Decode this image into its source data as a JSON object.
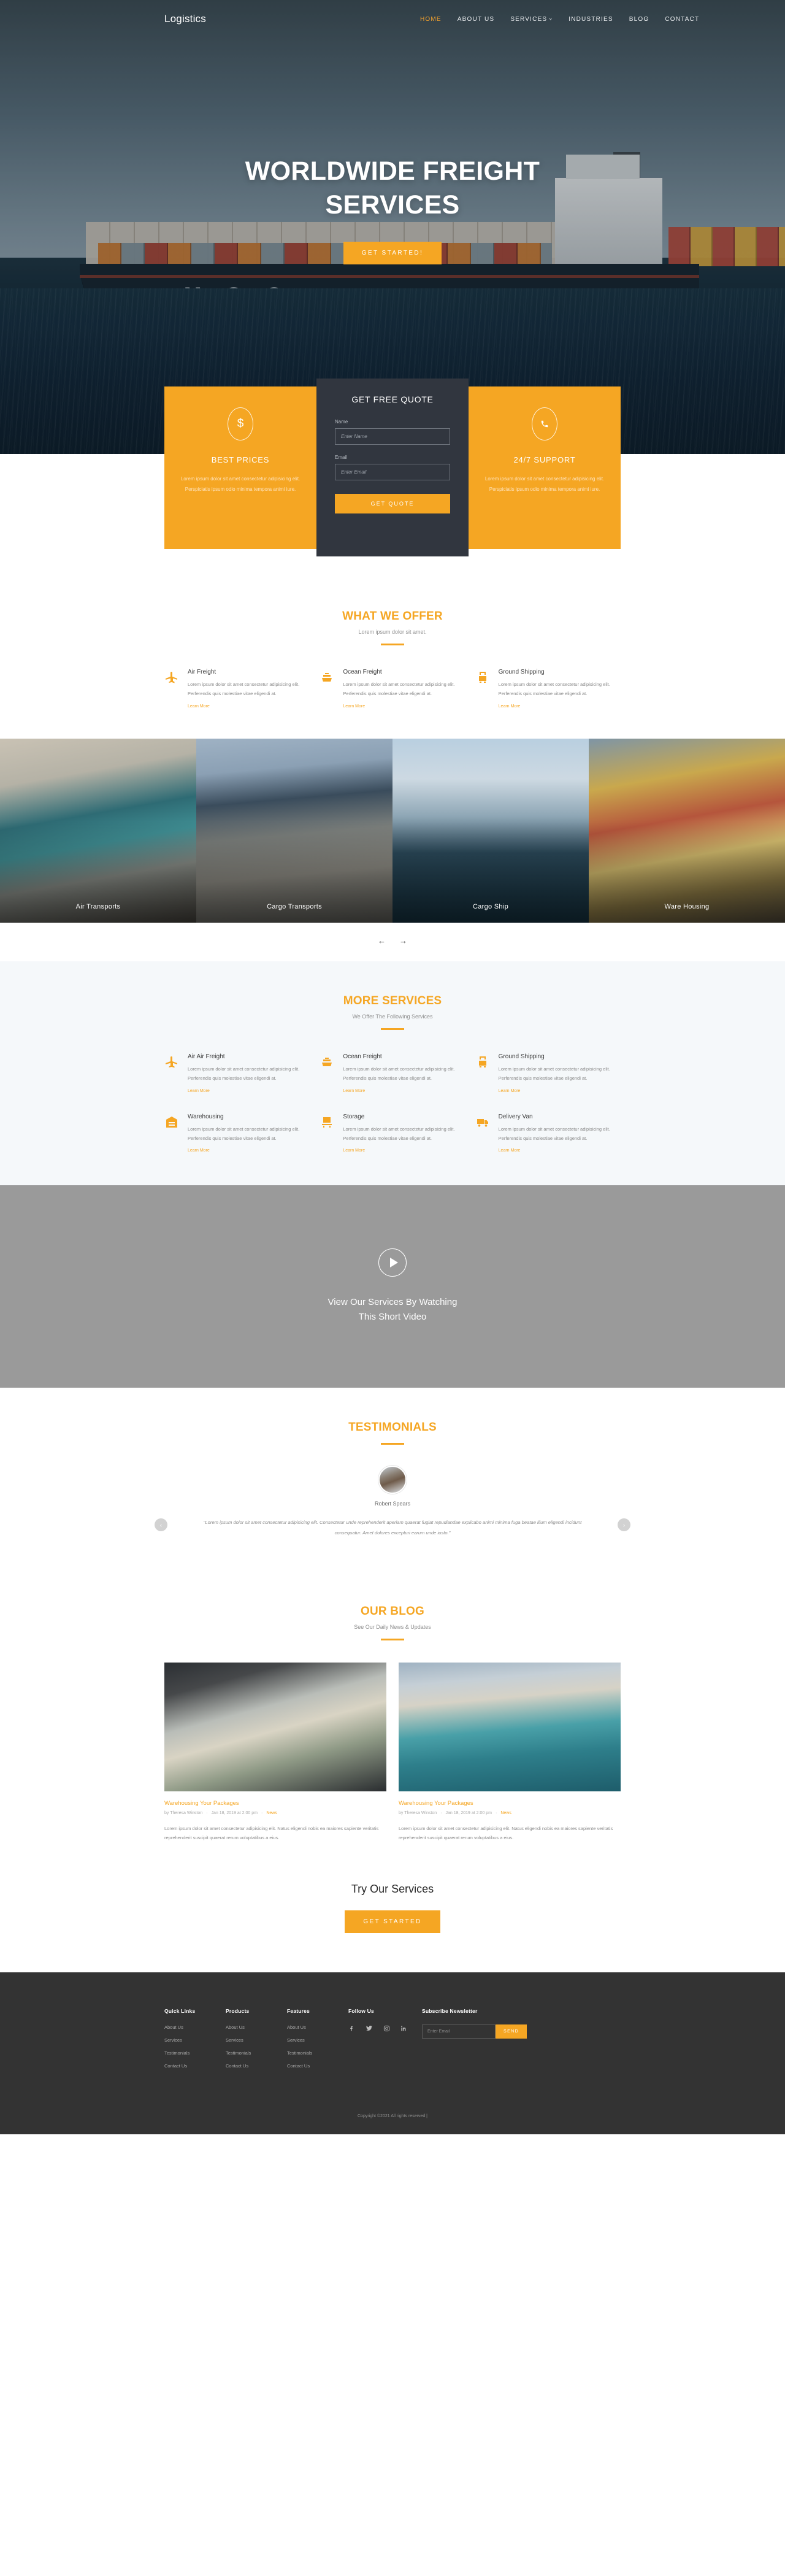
{
  "brand": "Logistics",
  "nav": {
    "items": [
      {
        "label": "HOME",
        "active": true
      },
      {
        "label": "ABOUT US",
        "active": false
      },
      {
        "label": "SERVICES",
        "active": false,
        "caret": "˅"
      },
      {
        "label": "INDUSTRIES",
        "active": false
      },
      {
        "label": "BLOG",
        "active": false
      },
      {
        "label": "CONTACT",
        "active": false
      }
    ]
  },
  "hero": {
    "title_line1": "WORLDWIDE FREIGHT",
    "title_line2": "SERVICES",
    "cta": "GET STARTED!"
  },
  "quote": {
    "left": {
      "icon": "dollar-icon",
      "glyph": "$",
      "title": "BEST PRICES",
      "text": "Lorem ipsum dolor sit amet consectetur adipisicing elit. Perspiciatis ipsum odio minima tempora animi iure."
    },
    "form": {
      "heading": "GET FREE QUOTE",
      "name_label": "Name",
      "name_placeholder": "Enter Name",
      "email_label": "Email",
      "email_placeholder": "Enter Email",
      "submit": "GET QUOTE"
    },
    "right": {
      "icon": "phone-icon",
      "glyph": "☎",
      "title": "24/7 SUPPORT",
      "text": "Lorem ipsum dolor sit amet consectetur adipisicing elit. Perspiciatis ipsum odio minima tempora animi iure."
    }
  },
  "offer": {
    "title": "WHAT WE OFFER",
    "subtitle": "Lorem ipsum dolor sit amet.",
    "items": [
      {
        "icon": "plane-icon",
        "name": "Air Freight",
        "desc": "Lorem ipsum dolor sit amet consectetur adipisicing elit. Perferendis quis molestiae vitae eligendi at.",
        "more": "Learn More"
      },
      {
        "icon": "ship-icon",
        "name": "Ocean Freight",
        "desc": "Lorem ipsum dolor sit amet consectetur adipisicing elit. Perferendis quis molestiae vitae eligendi at.",
        "more": "Learn More"
      },
      {
        "icon": "truck-icon",
        "name": "Ground Shipping",
        "desc": "Lorem ipsum dolor sit amet consectetur adipisicing elit. Perferendis quis molestiae vitae eligendi at.",
        "more": "Learn More"
      }
    ]
  },
  "gallery": {
    "items": [
      {
        "caption": "Air Transports"
      },
      {
        "caption": "Cargo Transports"
      },
      {
        "caption": "Cargo Ship"
      },
      {
        "caption": "Ware Housing"
      }
    ],
    "prev": "←",
    "next": "→"
  },
  "more_services": {
    "title": "MORE SERVICES",
    "subtitle": "We Offer The Following Services",
    "items": [
      {
        "icon": "plane-icon",
        "name": "Air Air Freight",
        "desc": "Lorem ipsum dolor sit amet consectetur adipisicing elit. Perferendis quis molestiae vitae eligendi at.",
        "more": "Learn More"
      },
      {
        "icon": "ship-icon",
        "name": "Ocean Freight",
        "desc": "Lorem ipsum dolor sit amet consectetur adipisicing elit. Perferendis quis molestiae vitae eligendi at.",
        "more": "Learn More"
      },
      {
        "icon": "truck-icon",
        "name": "Ground Shipping",
        "desc": "Lorem ipsum dolor sit amet consectetur adipisicing elit. Perferendis quis molestiae vitae eligendi at.",
        "more": "Learn More"
      },
      {
        "icon": "warehouse-icon",
        "name": "Warehousing",
        "desc": "Lorem ipsum dolor sit amet consectetur adipisicing elit. Perferendis quis molestiae vitae eligendi at.",
        "more": "Learn More"
      },
      {
        "icon": "box-icon",
        "name": "Storage",
        "desc": "Lorem ipsum dolor sit amet consectetur adipisicing elit. Perferendis quis molestiae vitae eligendi at.",
        "more": "Learn More"
      },
      {
        "icon": "van-icon",
        "name": "Delivery Van",
        "desc": "Lorem ipsum dolor sit amet consectetur adipisicing elit. Perferendis quis molestiae vitae eligendi at.",
        "more": "Learn More"
      }
    ]
  },
  "video": {
    "play_icon": "play-icon",
    "line1": "View Our Services By Watching",
    "line2": "This Short Video"
  },
  "testimonials": {
    "title": "TESTIMONIALS",
    "name": "Robert Spears",
    "quote": "\"Lorem ipsum dolor sit amet consectetur adipisicing elit. Consectetur unde reprehenderit aperiam quaerat fugiat repudiandae explicabo animi minima fuga beatae illum eligendi incidunt consequatur. Amet dolores excepturi earum unde iusto.\"",
    "prev": "‹",
    "next": "›"
  },
  "blog": {
    "title": "OUR BLOG",
    "subtitle": "See Our Daily News & Updates",
    "posts": [
      {
        "title": "Warehousing Your Packages",
        "author": "by Theresa Winston",
        "date": "Jan 18, 2019 at 2:00 pm",
        "category": "News",
        "text": "Lorem ipsum dolor sit amet consectetur adipisicing elit. Natus eligendi nobis ea maiores sapiente veritatis reprehenderit suscipit quaerat rerum voluptatibus a eius."
      },
      {
        "title": "Warehousing Your Packages",
        "author": "by Theresa Winston",
        "date": "Jan 18, 2019 at 2:00 pm",
        "category": "News",
        "text": "Lorem ipsum dolor sit amet consectetur adipisicing elit. Natus eligendi nobis ea maiores sapiente veritatis reprehenderit suscipit quaerat rerum voluptatibus a eius."
      }
    ]
  },
  "cta": {
    "title": "Try Our Services",
    "button": "GET STARTED"
  },
  "footer": {
    "columns": [
      {
        "head": "Quick Links",
        "links": [
          "About Us",
          "Services",
          "Testimonials",
          "Contact Us"
        ]
      },
      {
        "head": "Products",
        "links": [
          "About Us",
          "Services",
          "Testimonials",
          "Contact Us"
        ]
      },
      {
        "head": "Features",
        "links": [
          "About Us",
          "Services",
          "Testimonials",
          "Contact Us"
        ]
      }
    ],
    "follow": {
      "head": "Follow Us",
      "socials": [
        {
          "icon": "facebook-icon",
          "glyph": "f"
        },
        {
          "icon": "twitter-icon",
          "glyph": "ᴠ"
        },
        {
          "icon": "instagram-icon",
          "glyph": "□"
        },
        {
          "icon": "linkedin-icon",
          "glyph": "in"
        }
      ]
    },
    "newsletter": {
      "head": "Subscribe Newsletter",
      "placeholder": "Enter Email",
      "button": "SEND"
    },
    "copyright": "Copyright ©2021 All rights reserved |"
  },
  "colors": {
    "accent": "#f5a623",
    "dark": "#333333",
    "quote_panel": "#31363f"
  }
}
